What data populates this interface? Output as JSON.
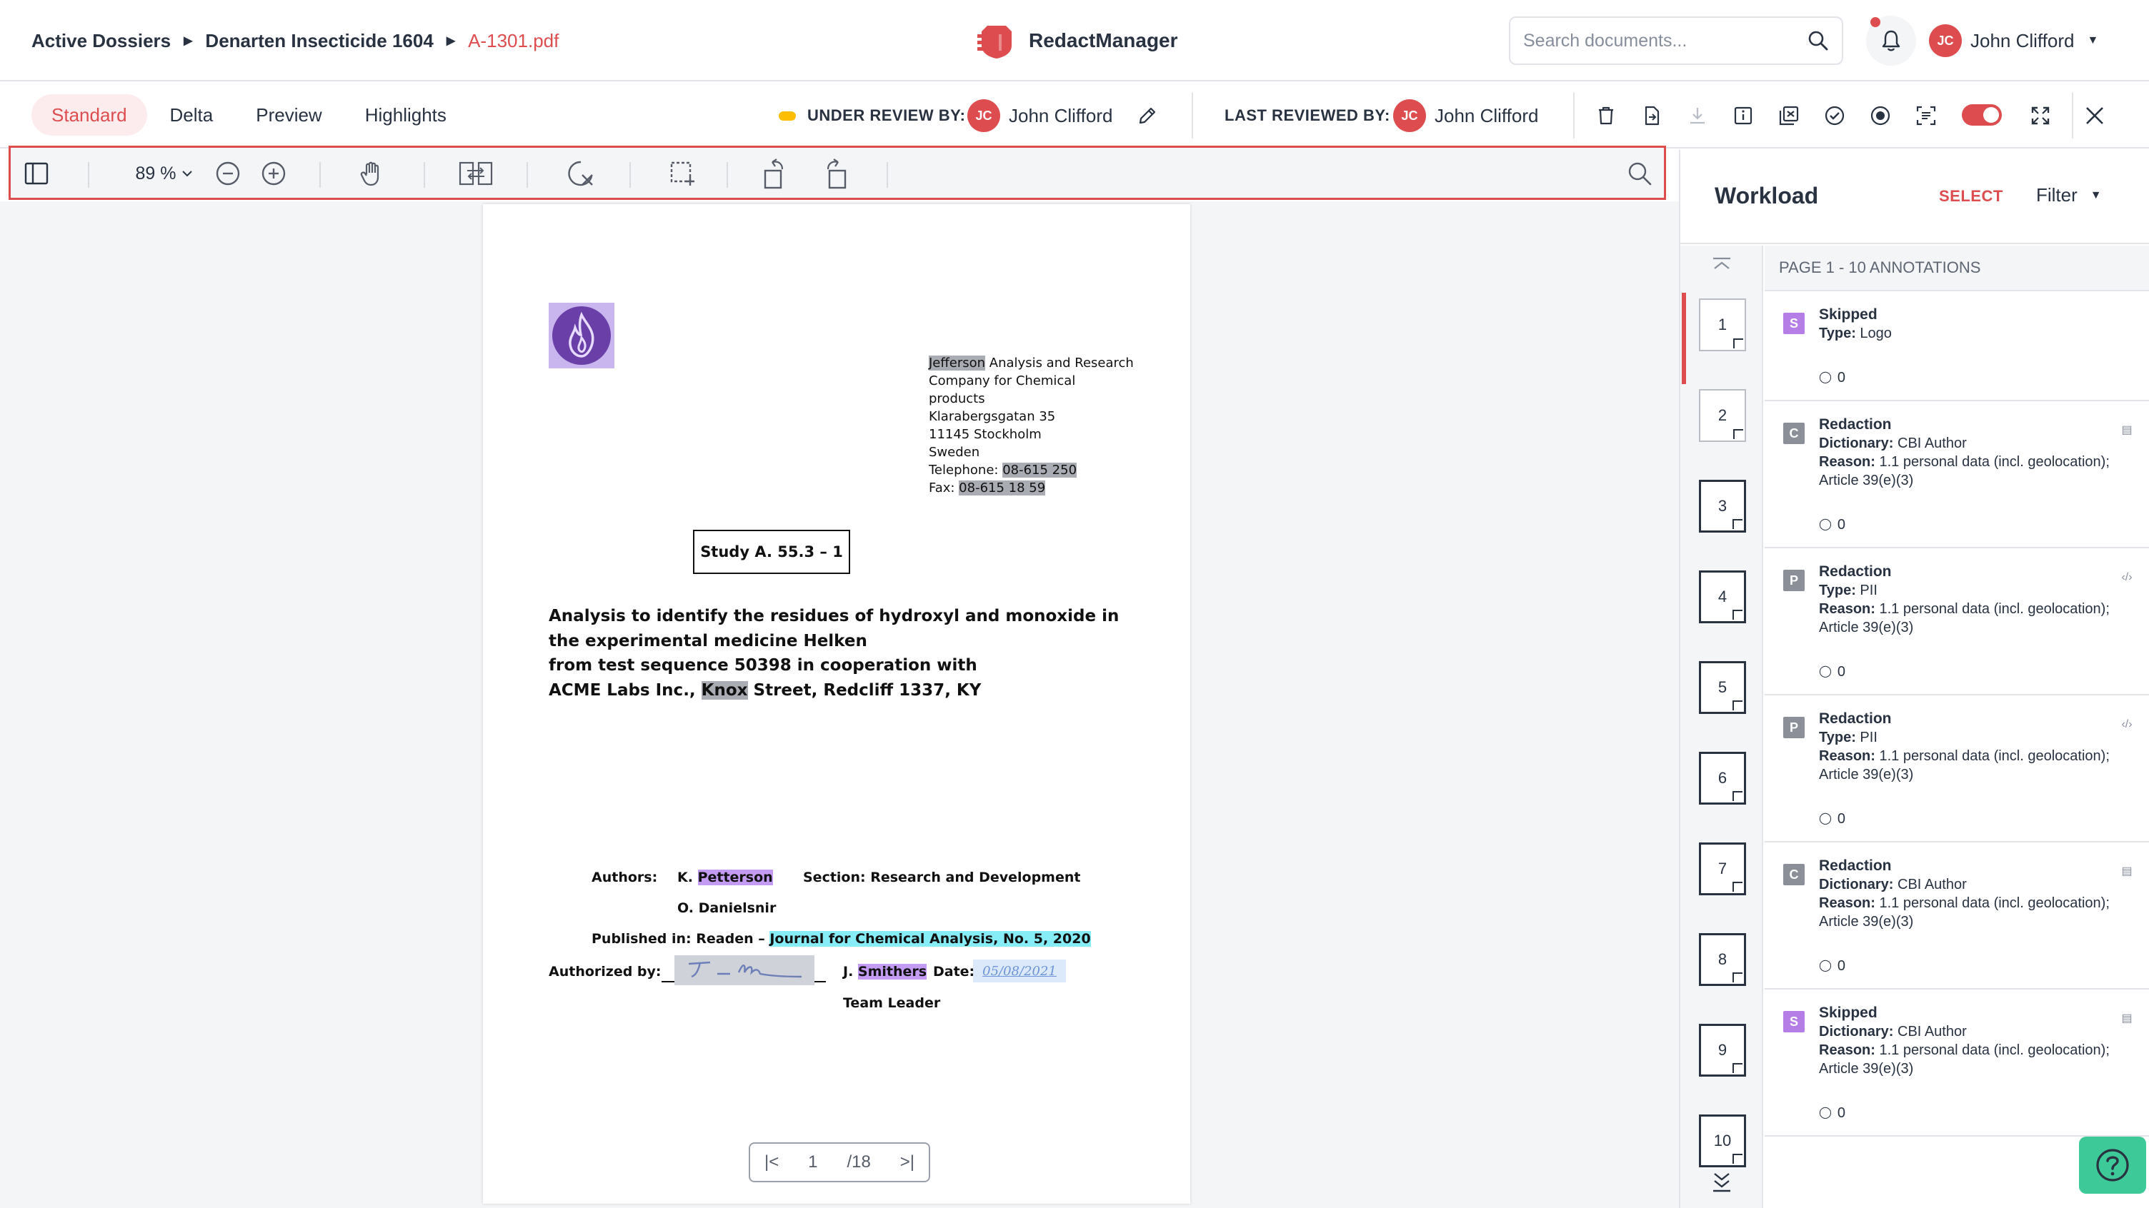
{
  "header": {
    "breadcrumb": [
      "Active Dossiers",
      "Denarten Insecticide 1604",
      "A-1301.pdf"
    ],
    "brand": "RedactManager",
    "search_placeholder": "Search documents...",
    "user": {
      "initials": "JC",
      "name": "John Clifford"
    }
  },
  "subheader": {
    "tabs": [
      "Standard",
      "Delta",
      "Preview",
      "Highlights"
    ],
    "active_tab": "Standard",
    "under_review_label": "UNDER REVIEW BY:",
    "under_review_user": "John Clifford",
    "last_reviewed_label": "LAST REVIEWED BY:",
    "last_reviewed_user": "John Clifford",
    "reviewer_initials": "JC"
  },
  "viewer_toolbar": {
    "zoom": "89 %"
  },
  "document": {
    "address": {
      "company_redacted": "Jefferson",
      "company_rest": " Analysis and Research",
      "line2": "Company for Chemical",
      "line3": "products",
      "street": "Klarabergsgatan 35",
      "city": "11145 Stockholm",
      "country": "Sweden",
      "phone_label": "Telephone: ",
      "phone": "08-615 250",
      "fax_label": "Fax: ",
      "fax": "08-615 18 59"
    },
    "study_label": "Study A. 55.3 – 1",
    "title_lines": [
      "Analysis to identify the residues of hydroxyl and monoxide in",
      "the experimental medicine Helken",
      "from test sequence 50398 in cooperation with"
    ],
    "title_line4_prefix": "ACME Labs Inc., ",
    "title_line4_redacted": "Knox",
    "title_line4_suffix": " Street, Redcliff 1337, KY",
    "authors_label": "Authors:",
    "author1_prefix": "K. ",
    "author1_redacted": "Petterson",
    "section": "Section: Research and Development",
    "author2": "O. Danielsnir",
    "published_label": "Published in: Readen – ",
    "published_journal": "Journal for Chemical Analysis, No. 5, 2020",
    "authorized_label": "Authorized by:",
    "signer_prefix": "J. ",
    "signer_redacted": "Smithers",
    "date_label": "Date:",
    "date_value": "05/08/2021",
    "signer_role": "Team Leader",
    "pager": {
      "current": "1",
      "total": "/18"
    }
  },
  "panel": {
    "title": "Workload",
    "select_label": "SELECT",
    "filter_label": "Filter",
    "annotations_header": "PAGE 1 - 10 ANNOTATIONS",
    "pages": [
      "1",
      "2",
      "3",
      "4",
      "5",
      "6",
      "7",
      "8",
      "9",
      "10"
    ],
    "annotations": [
      {
        "badge": "S",
        "badge_color": "#b57ee6",
        "title": "Skipped",
        "k1": "Type:",
        "v1": " Logo",
        "k2": "",
        "v2": "",
        "count": "0",
        "side_icon": ""
      },
      {
        "badge": "C",
        "badge_color": "#8a8f98",
        "title": "Redaction",
        "k1": "Dictionary:",
        "v1": " CBI Author",
        "k2": "Reason:",
        "v2": " 1.1 personal data (incl. geolocation); Article 39(e)(3)",
        "count": "0",
        "side_icon": "document-icon"
      },
      {
        "badge": "P",
        "badge_color": "#8a8f98",
        "title": "Redaction",
        "k1": "Type:",
        "v1": " PII",
        "k2": "Reason:",
        "v2": " 1.1 personal data (incl. geolocation); Article 39(e)(3)",
        "count": "0",
        "side_icon": "code-icon"
      },
      {
        "badge": "P",
        "badge_color": "#8a8f98",
        "title": "Redaction",
        "k1": "Type:",
        "v1": " PII",
        "k2": "Reason:",
        "v2": " 1.1 personal data (incl. geolocation); Article 39(e)(3)",
        "count": "0",
        "side_icon": "code-icon"
      },
      {
        "badge": "C",
        "badge_color": "#8a8f98",
        "title": "Redaction",
        "k1": "Dictionary:",
        "v1": " CBI Author",
        "k2": "Reason:",
        "v2": " 1.1 personal data (incl. geolocation); Article 39(e)(3)",
        "count": "0",
        "side_icon": "document-icon"
      },
      {
        "badge": "S",
        "badge_color": "#b57ee6",
        "title": "Skipped",
        "k1": "Dictionary:",
        "v1": " CBI Author",
        "k2": "Reason:",
        "v2": " 1.1 personal data (incl. geolocation); Article 39(e)(3)",
        "count": "0",
        "side_icon": "document-icon"
      }
    ]
  },
  "colors": {
    "accent": "#dd4d50",
    "help": "#3ec998",
    "review_status": "#fdbd00"
  }
}
